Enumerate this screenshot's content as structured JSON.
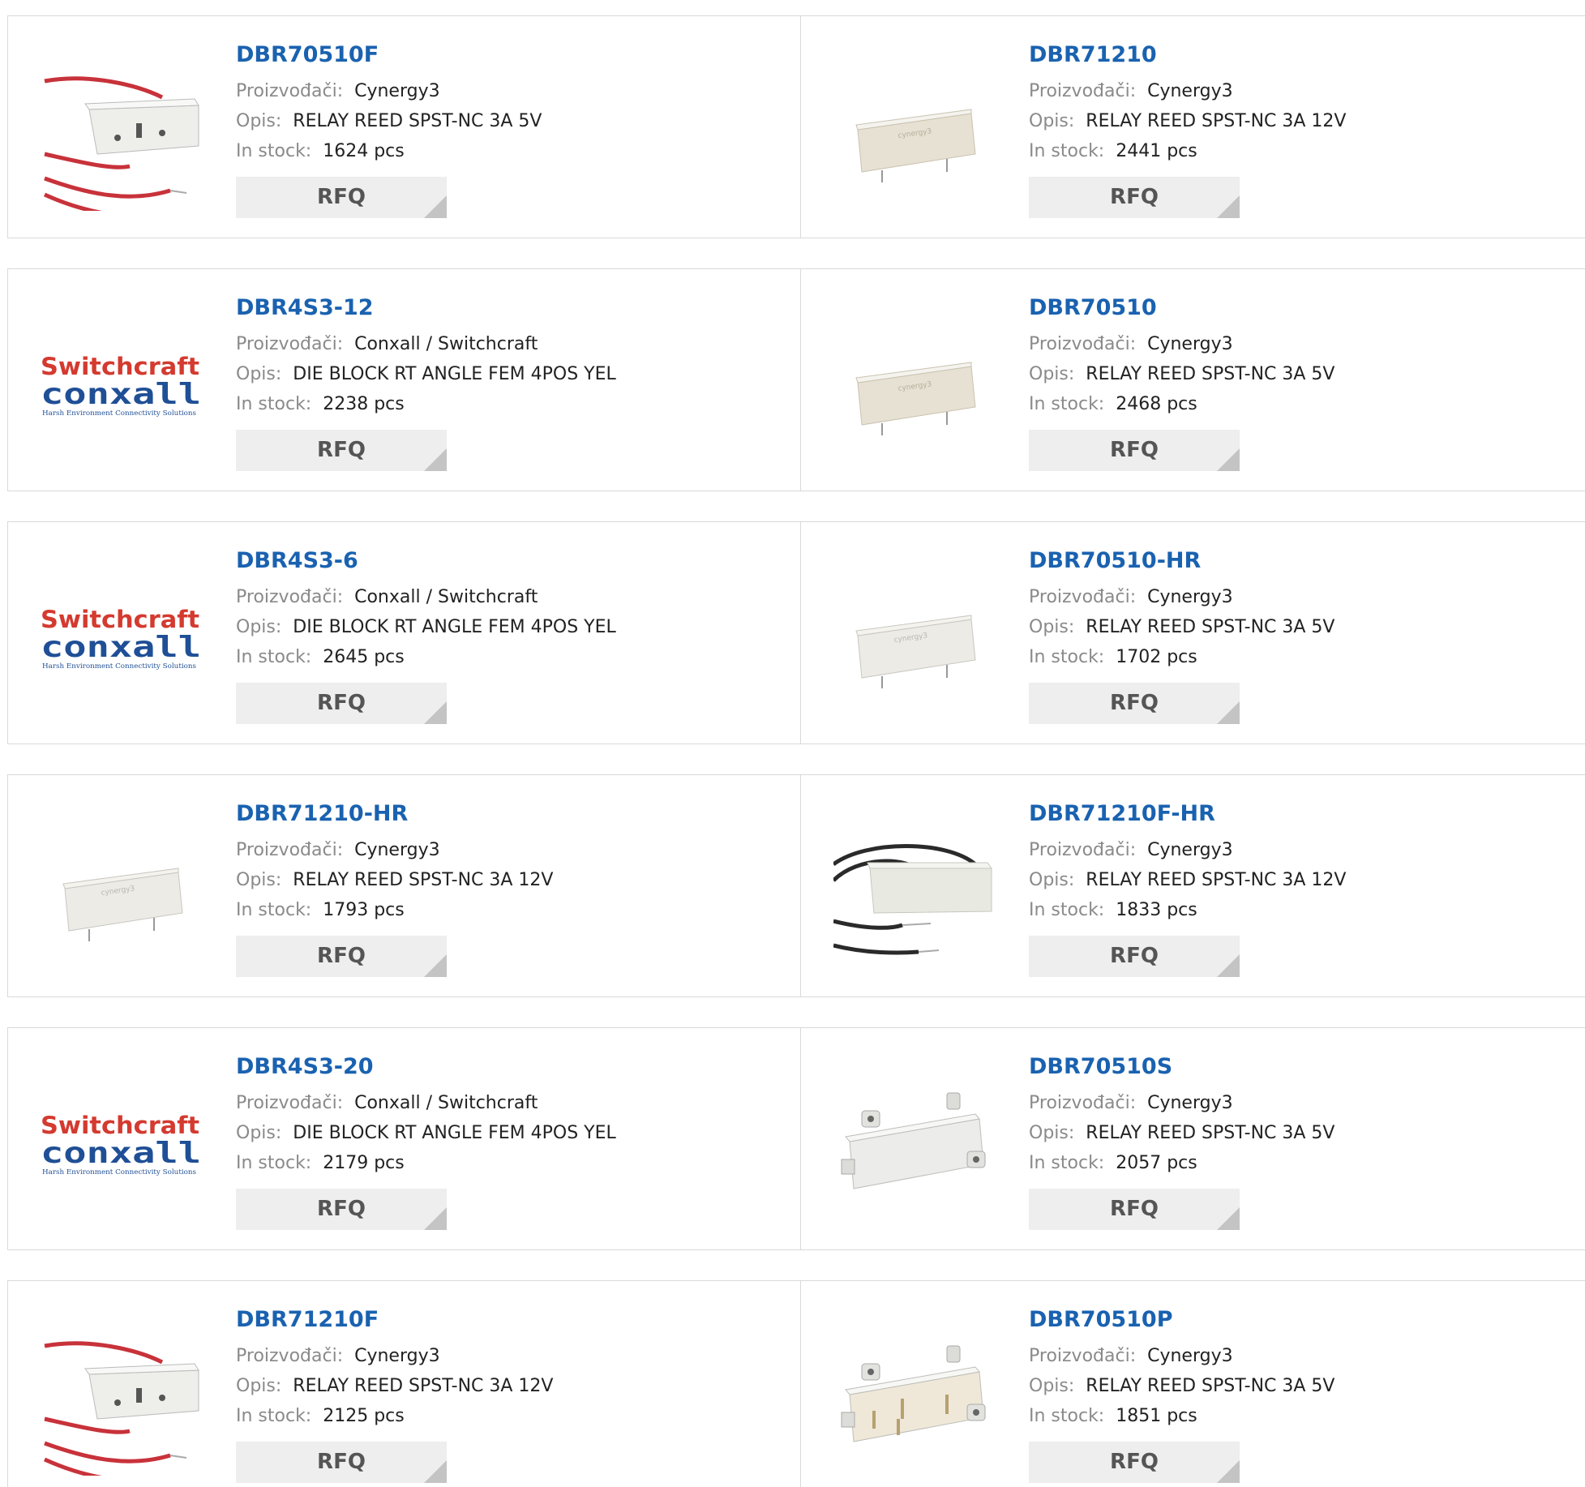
{
  "labels": {
    "manufacturer": "Proizvođači:",
    "description": "Opis:",
    "stock": "In stock:",
    "rfq": "RFQ"
  },
  "logo": {
    "top": "Switchcraft",
    "bottom": "conxall",
    "tagline": "Harsh Environment Connectivity Solutions"
  },
  "products": [
    {
      "pn": "DBR70510F",
      "manufacturer": "Cynergy3",
      "description": "RELAY REED SPST-NC 3A 5V",
      "stock": "1624 pcs",
      "image": "relay-red-leads"
    },
    {
      "pn": "DBR71210",
      "manufacturer": "Cynergy3",
      "description": "RELAY REED SPST-NC 3A 12V",
      "stock": "2441 pcs",
      "image": "relay-beige"
    },
    {
      "pn": "DBR4S3-12",
      "manufacturer": "Conxall / Switchcraft",
      "description": "DIE BLOCK RT ANGLE FEM 4POS YEL",
      "stock": "2238 pcs",
      "image": "switchcraft-logo"
    },
    {
      "pn": "DBR70510",
      "manufacturer": "Cynergy3",
      "description": "RELAY REED SPST-NC 3A 5V",
      "stock": "2468 pcs",
      "image": "relay-beige"
    },
    {
      "pn": "DBR4S3-6",
      "manufacturer": "Conxall / Switchcraft",
      "description": "DIE BLOCK RT ANGLE FEM 4POS YEL",
      "stock": "2645 pcs",
      "image": "switchcraft-logo"
    },
    {
      "pn": "DBR70510-HR",
      "manufacturer": "Cynergy3",
      "description": "RELAY REED SPST-NC 3A 5V",
      "stock": "1702 pcs",
      "image": "relay-white"
    },
    {
      "pn": "DBR71210-HR",
      "manufacturer": "Cynergy3",
      "description": "RELAY REED SPST-NC 3A 12V",
      "stock": "1793 pcs",
      "image": "relay-white"
    },
    {
      "pn": "DBR71210F-HR",
      "manufacturer": "Cynergy3",
      "description": "RELAY REED SPST-NC 3A 12V",
      "stock": "1833 pcs",
      "image": "relay-black-leads"
    },
    {
      "pn": "DBR4S3-20",
      "manufacturer": "Conxall / Switchcraft",
      "description": "DIE BLOCK RT ANGLE FEM 4POS YEL",
      "stock": "2179 pcs",
      "image": "switchcraft-logo"
    },
    {
      "pn": "DBR70510S",
      "manufacturer": "Cynergy3",
      "description": "RELAY REED SPST-NC 3A 5V",
      "stock": "2057 pcs",
      "image": "relay-bracket"
    },
    {
      "pn": "DBR71210F",
      "manufacturer": "Cynergy3",
      "description": "RELAY REED SPST-NC 3A 12V",
      "stock": "2125 pcs",
      "image": "relay-red-leads"
    },
    {
      "pn": "DBR70510P",
      "manufacturer": "Cynergy3",
      "description": "RELAY REED SPST-NC 3A 5V",
      "stock": "1851 pcs",
      "image": "relay-bracket-pins"
    }
  ],
  "colors": {
    "link": "#1a62b0",
    "label": "#8a8a8a",
    "value": "#222222",
    "button_bg": "#eeeeee",
    "border": "#d9d9d9"
  }
}
